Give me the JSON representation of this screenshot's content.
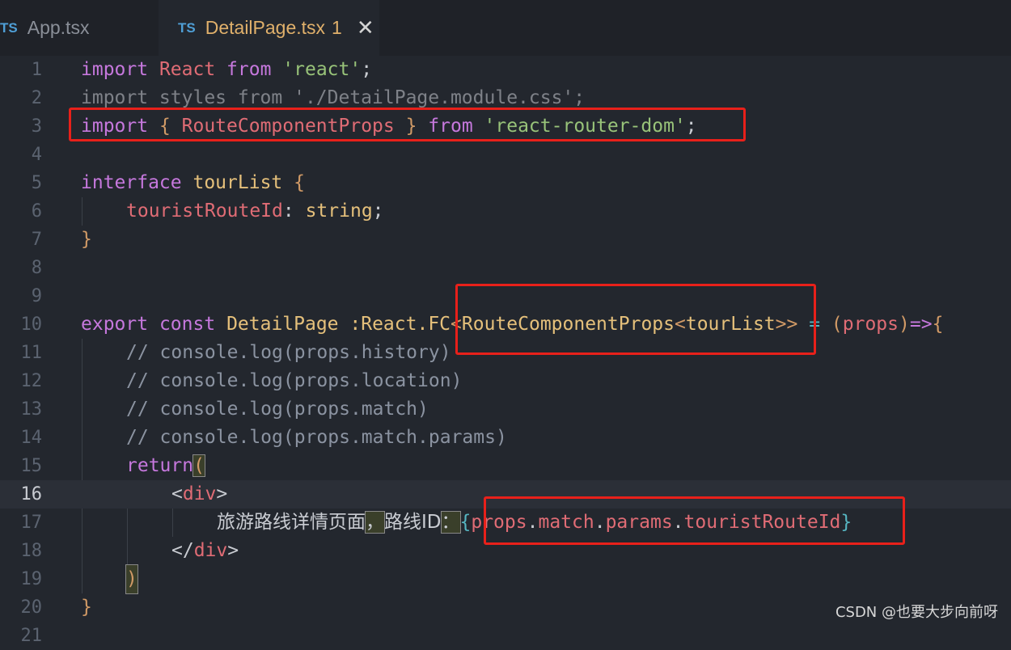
{
  "tabs": [
    {
      "badge": "TS",
      "label": "App.tsx"
    },
    {
      "badge": "TS",
      "label": "DetailPage.tsx",
      "modified": "1",
      "close": "✕"
    }
  ],
  "lines": {
    "l1": {
      "n": "1",
      "t": [
        "import",
        " React ",
        "from",
        " ",
        "'react'",
        ";"
      ]
    },
    "l2": {
      "n": "2",
      "t": "import styles from './DetailPage.module.css';"
    },
    "l3": {
      "n": "3",
      "t": [
        "import",
        " { ",
        "RouteComponentProps",
        " } ",
        "from",
        " ",
        "'react-router-dom'",
        ";"
      ]
    },
    "l4": {
      "n": "4"
    },
    "l5": {
      "n": "5",
      "t": [
        "interface",
        " ",
        "tourList",
        " ",
        "{"
      ]
    },
    "l6": {
      "n": "6",
      "t": [
        "touristRouteId",
        ": ",
        "string",
        ";"
      ]
    },
    "l7": {
      "n": "7",
      "t": "}"
    },
    "l8": {
      "n": "8"
    },
    "l9": {
      "n": "9"
    },
    "l10": {
      "n": "10",
      "t": [
        "export",
        " ",
        "const",
        " ",
        "DetailPage",
        " :React.FC",
        "<",
        "RouteComponentProps",
        "<",
        "tourList",
        ">>",
        " = ",
        "(",
        "props",
        ")",
        "=>",
        "{"
      ]
    },
    "l11": {
      "n": "11",
      "t": "// console.log(props.history)"
    },
    "l12": {
      "n": "12",
      "t": "// console.log(props.location)"
    },
    "l13": {
      "n": "13",
      "t": "// console.log(props.match)"
    },
    "l14": {
      "n": "14",
      "t": "// console.log(props.match.params)"
    },
    "l15": {
      "n": "15",
      "t": [
        "return",
        "("
      ]
    },
    "l16": {
      "n": "16",
      "t": [
        "<",
        "div",
        ">"
      ]
    },
    "l17": {
      "n": "17",
      "t": [
        "旅游路线详情页面",
        "，",
        "路线ID",
        "：",
        "{",
        "props",
        ".",
        "match",
        ".",
        "params",
        ".",
        "touristRouteId",
        "}"
      ]
    },
    "l18": {
      "n": "18",
      "t": [
        "</",
        "div",
        ">"
      ]
    },
    "l19": {
      "n": "19",
      "t": ")"
    },
    "l20": {
      "n": "20",
      "t": "}"
    },
    "l21": {
      "n": "21"
    }
  },
  "watermark": "CSDN @也要大步向前呀",
  "colors": {
    "highlight_box": "#e8201a",
    "background": "#23272e"
  }
}
